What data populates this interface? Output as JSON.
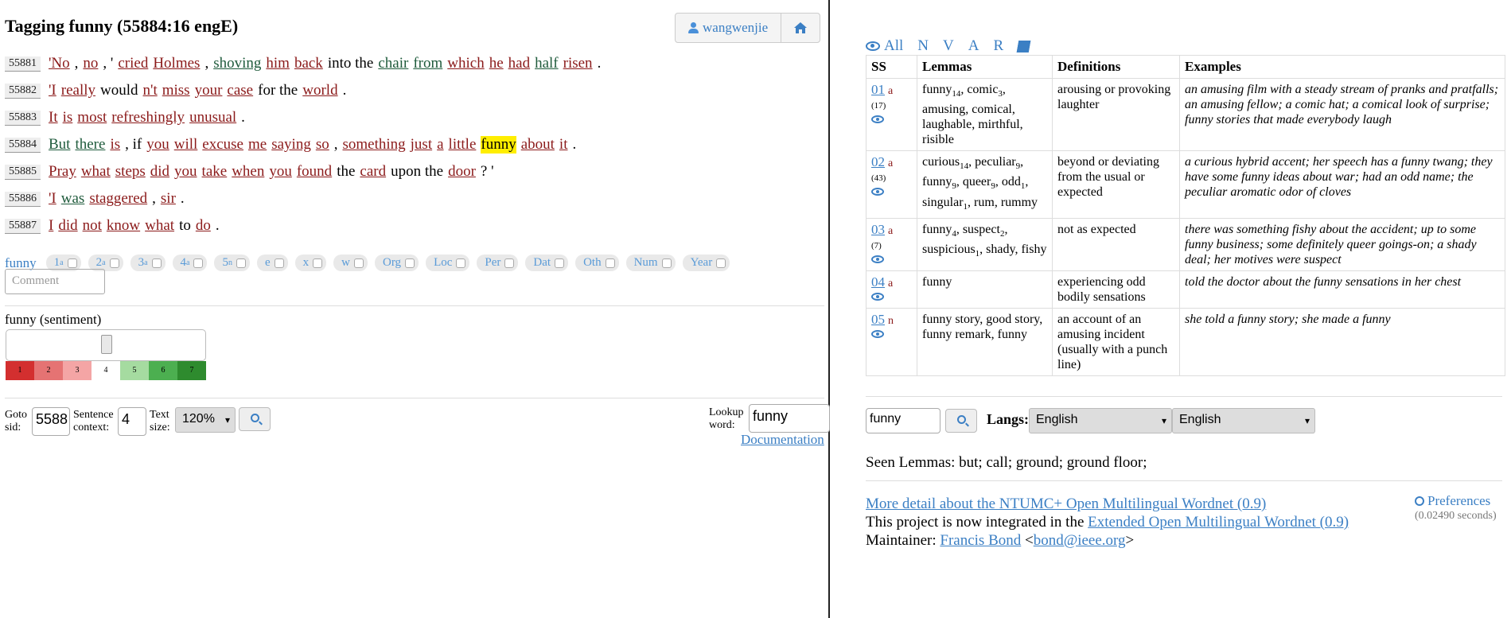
{
  "header": {
    "title": "Tagging funny (55884:16 engE)",
    "user_label": "wangwenjie",
    "icons": {
      "user": "user-icon",
      "home": "home-icon"
    }
  },
  "sentences": [
    {
      "sid": "55881",
      "words": [
        {
          "t": "'No",
          "tag": "red"
        },
        {
          "t": ",",
          "tag": "none"
        },
        {
          "t": "no",
          "tag": "red"
        },
        {
          "t": ", '",
          "tag": "none"
        },
        {
          "t": "cried",
          "tag": "red"
        },
        {
          "t": "Holmes",
          "tag": "red"
        },
        {
          "t": ",",
          "tag": "none"
        },
        {
          "t": "shoving",
          "tag": "green"
        },
        {
          "t": "him",
          "tag": "red"
        },
        {
          "t": "back",
          "tag": "red"
        },
        {
          "t": "into the",
          "tag": "none"
        },
        {
          "t": "chair",
          "tag": "green"
        },
        {
          "t": "from",
          "tag": "green"
        },
        {
          "t": "which",
          "tag": "red"
        },
        {
          "t": "he",
          "tag": "red"
        },
        {
          "t": "had",
          "tag": "red"
        },
        {
          "t": "half",
          "tag": "green"
        },
        {
          "t": "risen",
          "tag": "red"
        },
        {
          "t": ".",
          "tag": "none"
        }
      ]
    },
    {
      "sid": "55882",
      "words": [
        {
          "t": "'I",
          "tag": "red"
        },
        {
          "t": "really",
          "tag": "red"
        },
        {
          "t": "would",
          "tag": "none"
        },
        {
          "t": "n't",
          "tag": "red"
        },
        {
          "t": "miss",
          "tag": "red"
        },
        {
          "t": "your",
          "tag": "red"
        },
        {
          "t": "case",
          "tag": "red"
        },
        {
          "t": "for the",
          "tag": "none"
        },
        {
          "t": "world",
          "tag": "red"
        },
        {
          "t": ".",
          "tag": "none"
        }
      ]
    },
    {
      "sid": "55883",
      "words": [
        {
          "t": "It",
          "tag": "red"
        },
        {
          "t": "is",
          "tag": "red"
        },
        {
          "t": "most",
          "tag": "red"
        },
        {
          "t": "refreshingly",
          "tag": "red"
        },
        {
          "t": "unusual",
          "tag": "red"
        },
        {
          "t": ".",
          "tag": "none"
        }
      ]
    },
    {
      "sid": "55884",
      "words": [
        {
          "t": "But",
          "tag": "green"
        },
        {
          "t": "there",
          "tag": "green"
        },
        {
          "t": "is",
          "tag": "red"
        },
        {
          "t": ", if",
          "tag": "none"
        },
        {
          "t": "you",
          "tag": "red"
        },
        {
          "t": "will",
          "tag": "red"
        },
        {
          "t": "excuse",
          "tag": "red"
        },
        {
          "t": "me",
          "tag": "red"
        },
        {
          "t": "saying",
          "tag": "red"
        },
        {
          "t": "so",
          "tag": "red"
        },
        {
          "t": ",",
          "tag": "none"
        },
        {
          "t": "something",
          "tag": "red"
        },
        {
          "t": "just",
          "tag": "red"
        },
        {
          "t": "a",
          "tag": "red"
        },
        {
          "t": "little",
          "tag": "red"
        },
        {
          "t": "funny",
          "tag": "hl"
        },
        {
          "t": "about",
          "tag": "red"
        },
        {
          "t": "it",
          "tag": "red"
        },
        {
          "t": ".",
          "tag": "none"
        }
      ]
    },
    {
      "sid": "55885",
      "words": [
        {
          "t": "Pray",
          "tag": "red"
        },
        {
          "t": "what",
          "tag": "red"
        },
        {
          "t": "steps",
          "tag": "red"
        },
        {
          "t": "did",
          "tag": "red"
        },
        {
          "t": "you",
          "tag": "red"
        },
        {
          "t": "take",
          "tag": "red"
        },
        {
          "t": "when",
          "tag": "red"
        },
        {
          "t": "you",
          "tag": "red"
        },
        {
          "t": "found",
          "tag": "red"
        },
        {
          "t": "the",
          "tag": "none"
        },
        {
          "t": "card",
          "tag": "red"
        },
        {
          "t": "upon the",
          "tag": "none"
        },
        {
          "t": "door",
          "tag": "red"
        },
        {
          "t": "? '",
          "tag": "none"
        }
      ]
    },
    {
      "sid": "55886",
      "words": [
        {
          "t": "'I",
          "tag": "red"
        },
        {
          "t": "was",
          "tag": "green"
        },
        {
          "t": "staggered",
          "tag": "red"
        },
        {
          "t": ",",
          "tag": "none"
        },
        {
          "t": "sir",
          "tag": "red"
        },
        {
          "t": ".",
          "tag": "none"
        }
      ]
    },
    {
      "sid": "55887",
      "words": [
        {
          "t": "I",
          "tag": "red"
        },
        {
          "t": "did",
          "tag": "red"
        },
        {
          "t": "not",
          "tag": "red"
        },
        {
          "t": "know",
          "tag": "red"
        },
        {
          "t": "what",
          "tag": "red"
        },
        {
          "t": "to",
          "tag": "none"
        },
        {
          "t": "do",
          "tag": "red"
        },
        {
          "t": ".",
          "tag": "none"
        }
      ]
    }
  ],
  "tagbar": {
    "lemma": "funny",
    "chips": [
      {
        "main": "1",
        "sub": "a"
      },
      {
        "main": "2",
        "sub": "a"
      },
      {
        "main": "3",
        "sub": "a"
      },
      {
        "main": "4",
        "sub": "a"
      },
      {
        "main": "5",
        "sub": "n"
      },
      {
        "main": "e",
        "sub": ""
      },
      {
        "main": "x",
        "sub": ""
      },
      {
        "main": "w",
        "sub": ""
      },
      {
        "main": "Org",
        "sub": ""
      },
      {
        "main": "Loc",
        "sub": ""
      },
      {
        "main": "Per",
        "sub": ""
      },
      {
        "main": "Dat",
        "sub": ""
      },
      {
        "main": "Oth",
        "sub": ""
      },
      {
        "main": "Num",
        "sub": ""
      },
      {
        "main": "Year",
        "sub": ""
      }
    ],
    "comment_placeholder": "Comment"
  },
  "sentiment": {
    "label": "funny (sentiment)",
    "value": 4,
    "scale": [
      {
        "n": "1",
        "color": "#d32f2f"
      },
      {
        "n": "2",
        "color": "#e57373"
      },
      {
        "n": "3",
        "color": "#f4a5a5"
      },
      {
        "n": "4",
        "color": "#ffffff"
      },
      {
        "n": "5",
        "color": "#a5dba0"
      },
      {
        "n": "6",
        "color": "#4caf50"
      },
      {
        "n": "7",
        "color": "#2e8b2e"
      }
    ]
  },
  "controls": {
    "goto_label": "Goto sid:",
    "goto_value": "5588",
    "context_label": "Sentence context:",
    "context_value": "4",
    "textsize_label": "Text size:",
    "textsize_value": "120%",
    "lookup_label": "Lookup word:",
    "lookup_value": "funny",
    "documentation": "Documentation"
  },
  "filters": {
    "all": "All",
    "n": "N",
    "v": "V",
    "a": "A",
    "r": "R"
  },
  "synsets": {
    "headers": [
      "SS",
      "Lemmas",
      "Definitions",
      "Examples"
    ],
    "rows": [
      {
        "num": "01",
        "pos": "a",
        "freq": "(17)",
        "lemmas": [
          [
            "funny",
            "14"
          ],
          [
            "comic",
            "3"
          ],
          [
            "amusing",
            ""
          ],
          [
            "comical",
            ""
          ],
          [
            "laughable",
            ""
          ],
          [
            "mirthful",
            ""
          ],
          [
            "risible",
            ""
          ]
        ],
        "def": "arousing or provoking laughter",
        "ex": "an amusing film with a steady stream of pranks and pratfalls; an amusing fellow; a comic hat; a comical look of surprise; funny stories that made everybody laugh"
      },
      {
        "num": "02",
        "pos": "a",
        "freq": "(43)",
        "lemmas": [
          [
            "curious",
            "14"
          ],
          [
            "peculiar",
            "9"
          ],
          [
            "funny",
            "9"
          ],
          [
            "queer",
            "9"
          ],
          [
            "odd",
            "1"
          ],
          [
            "singular",
            "1"
          ],
          [
            "rum",
            ""
          ],
          [
            "rummy",
            ""
          ]
        ],
        "def": "beyond or deviating from the usual or expected",
        "ex": "a curious hybrid accent; her speech has a funny twang; they have some funny ideas about war; had an odd name; the peculiar aromatic odor of cloves"
      },
      {
        "num": "03",
        "pos": "a",
        "freq": "(7)",
        "lemmas": [
          [
            "funny",
            "4"
          ],
          [
            "suspect",
            "2"
          ],
          [
            "suspicious",
            "1"
          ],
          [
            "shady",
            ""
          ],
          [
            "fishy",
            ""
          ]
        ],
        "def": "not as expected",
        "ex": "there was something fishy about the accident; up to some funny business; some definitely queer goings-on; a shady deal; her motives were suspect"
      },
      {
        "num": "04",
        "pos": "a",
        "freq": "",
        "lemmas": [
          [
            "funny",
            ""
          ]
        ],
        "def": "experiencing odd bodily sensations",
        "ex": "told the doctor about the funny sensations in her chest"
      },
      {
        "num": "05",
        "pos": "n",
        "freq": "",
        "lemmas": [
          [
            "funny story",
            ""
          ],
          [
            "good story",
            ""
          ],
          [
            "funny remark",
            ""
          ],
          [
            "funny",
            ""
          ]
        ],
        "def": "an account of an amusing incident (usually with a punch line)",
        "ex": "she told a funny story; she made a funny"
      }
    ]
  },
  "lookup": {
    "value": "funny",
    "langs_label": "Langs:",
    "lang1": "English",
    "lang2": "English"
  },
  "seen": "Seen Lemmas: but; call; ground; ground floor;",
  "footer": {
    "more_link": "More detail about the NTUMC+ Open Multilingual Wordnet (0.9)",
    "integrated_text": "This project is now integrated in the",
    "integrated_link": "Extended Open Multilingual Wordnet (0.9)",
    "maintainer_text": "Maintainer:",
    "maintainer_name": "Francis Bond",
    "maintainer_email": "bond@ieee.org",
    "preferences": "Preferences",
    "timing": "(0.02490 seconds)"
  }
}
